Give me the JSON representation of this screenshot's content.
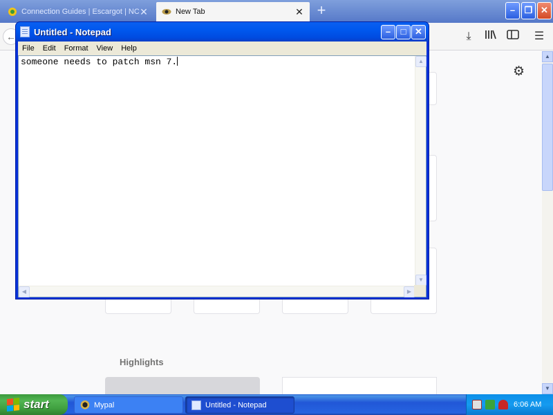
{
  "browser": {
    "tabs": [
      {
        "title": "Connection Guides | Escargot | NC",
        "active": false
      },
      {
        "title": "New Tab",
        "active": true
      }
    ],
    "new_tab_symbol": "+",
    "window_buttons": {
      "minimize": "–",
      "maximize": "❐",
      "close": "✕"
    },
    "nav": {
      "back": "←",
      "download": "⤓",
      "library": "|||\\",
      "sidebar": "▯",
      "menu": "☰"
    },
    "newtab": {
      "settings_icon": "gear-icon",
      "highlights_title": "Highlights"
    }
  },
  "notepad": {
    "title": "Untitled - Notepad",
    "window_buttons": {
      "minimize": "–",
      "maximize": "□",
      "close": "✕"
    },
    "menu": [
      "File",
      "Edit",
      "Format",
      "View",
      "Help"
    ],
    "content": "someone needs to patch msn 7.",
    "scroll_arrows": {
      "up": "▲",
      "down": "▼",
      "left": "◀",
      "right": "▶"
    }
  },
  "taskbar": {
    "start_label": "start",
    "buttons": [
      {
        "label": "Mypal",
        "active": false
      },
      {
        "label": "Untitled - Notepad",
        "active": true
      }
    ],
    "clock": "6:06 AM"
  },
  "colors": {
    "xp_blue": "#0058ee",
    "taskbar_blue": "#2157d7",
    "start_green": "#3f9f3f",
    "tray_blue": "#159bf0"
  }
}
